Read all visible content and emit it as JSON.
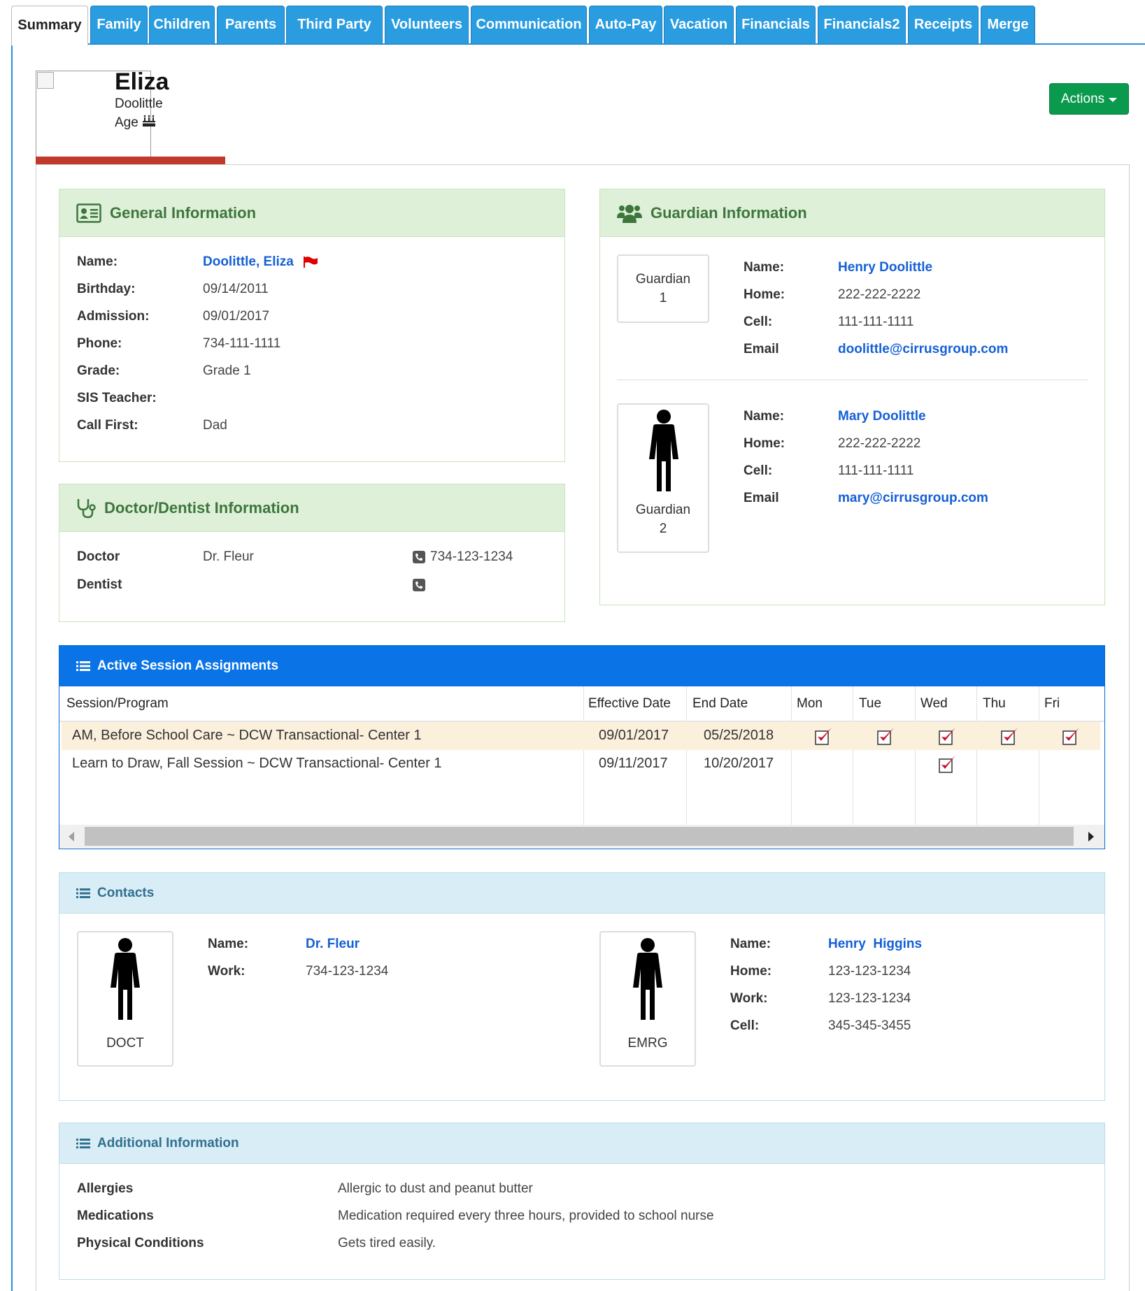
{
  "tabs": [
    {
      "label": "Summary",
      "active": true
    },
    {
      "label": "Family"
    },
    {
      "label": "Children"
    },
    {
      "label": "Parents"
    },
    {
      "label": "Third Party"
    },
    {
      "label": "Volunteers"
    },
    {
      "label": "Communication"
    },
    {
      "label": "Auto-Pay"
    },
    {
      "label": "Vacation"
    },
    {
      "label": "Financials"
    },
    {
      "label": "Financials2"
    },
    {
      "label": "Receipts"
    },
    {
      "label": "Merge"
    }
  ],
  "header": {
    "first_name": "Eliza",
    "last_name": "Doolittle",
    "age_label": "Age",
    "actions_label": "Actions"
  },
  "general": {
    "title": "General Information",
    "labels": {
      "name": "Name:",
      "birthday": "Birthday:",
      "admission": "Admission:",
      "phone": "Phone:",
      "grade": "Grade:",
      "sis_teacher": "SIS Teacher:",
      "call_first": "Call First:"
    },
    "values": {
      "name": "Doolittle, Eliza",
      "birthday": "09/14/2011",
      "admission": "09/01/2017",
      "phone": "734-111-1111",
      "grade": "Grade 1",
      "sis_teacher": "",
      "call_first": "Dad"
    }
  },
  "doctor": {
    "title": "Doctor/Dentist Information",
    "doctor_label": "Doctor",
    "doctor_name": "Dr. Fleur",
    "doctor_phone": "734-123-1234",
    "dentist_label": "Dentist",
    "dentist_name": "",
    "dentist_phone": ""
  },
  "guardian": {
    "title": "Guardian Information",
    "labels": {
      "name": "Name:",
      "home": "Home:",
      "cell": "Cell:",
      "email": "Email"
    },
    "items": [
      {
        "card_line1": "Guardian",
        "card_line2": "1",
        "name": "Henry Doolittle",
        "home": "222-222-2222",
        "cell": "111-111-1111",
        "email": "doolittle@cirrusgroup.com"
      },
      {
        "card_line1": "Guardian",
        "card_line2": "2",
        "name": "Mary Doolittle",
        "home": "222-222-2222",
        "cell": "111-111-1111",
        "email": "mary@cirrusgroup.com"
      }
    ]
  },
  "sessions": {
    "title": "Active Session Assignments",
    "columns": [
      "Session/Program",
      "Effective Date",
      "End Date",
      "Mon",
      "Tue",
      "Wed",
      "Thu",
      "Fri"
    ],
    "rows": [
      {
        "program": "AM, Before School Care ~ DCW Transactional- Center 1",
        "effective": "09/01/2017",
        "end": "05/25/2018",
        "days": [
          true,
          true,
          true,
          true,
          true
        ]
      },
      {
        "program": "Learn to Draw, Fall Session ~ DCW Transactional- Center 1",
        "effective": "09/11/2017",
        "end": "10/20/2017",
        "days": [
          false,
          false,
          true,
          false,
          false
        ]
      }
    ]
  },
  "contacts": {
    "title": "Contacts",
    "labels": {
      "name": "Name:",
      "work": "Work:",
      "home": "Home:",
      "cell": "Cell:"
    },
    "items": [
      {
        "card_label": "DOCT",
        "name": "Dr. Fleur",
        "work": "734-123-1234"
      },
      {
        "card_label": "EMRG",
        "name": "Henry  Higgins",
        "home": "123-123-1234",
        "work": "123-123-1234",
        "cell": "345-345-3455"
      }
    ]
  },
  "additional": {
    "title": "Additional Information",
    "rows": [
      {
        "label": "Allergies",
        "value": "Allergic to dust and peanut butter"
      },
      {
        "label": "Medications",
        "value": "Medication required every three hours, provided to school nurse"
      },
      {
        "label": "Physical Conditions",
        "value": "Gets tired easily."
      }
    ]
  },
  "colors": {
    "tab_blue": "#2a9ce0",
    "green_header": "#dff0d8",
    "green_text": "#3c763d",
    "blue_header": "#d9edf7",
    "session_blue": "#0a73e6",
    "link": "#1560d6",
    "action_green": "#0a9a4e",
    "flag_red": "#e00000"
  },
  "icons": [
    "id-card-icon",
    "users-icon",
    "stethoscope-icon",
    "list-icon",
    "phone-icon",
    "flag-icon",
    "birthday-cake-icon",
    "person-icon",
    "checkmark-icon",
    "caret-down-icon"
  ]
}
